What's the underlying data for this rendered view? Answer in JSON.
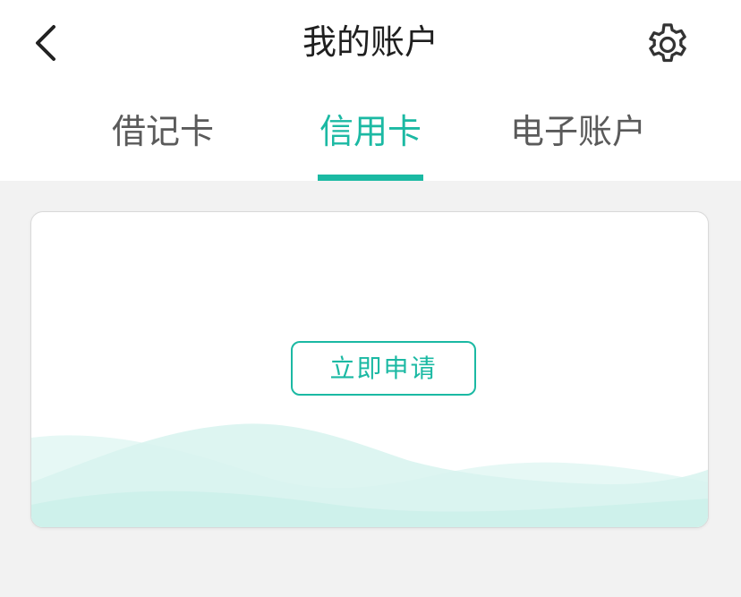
{
  "header": {
    "title": "我的账户",
    "back_icon": "chevron-left-icon",
    "settings_icon": "gear-icon"
  },
  "tabs": [
    {
      "label": "借记卡",
      "active": false
    },
    {
      "label": "信用卡",
      "active": true
    },
    {
      "label": "电子账户",
      "active": false
    }
  ],
  "card": {
    "apply_label": "立即申请"
  },
  "colors": {
    "accent": "#1bb9a3",
    "page_bg": "#f2f2f2",
    "wave_light": "#e6f8f5",
    "wave_dark": "#c9efe8"
  }
}
